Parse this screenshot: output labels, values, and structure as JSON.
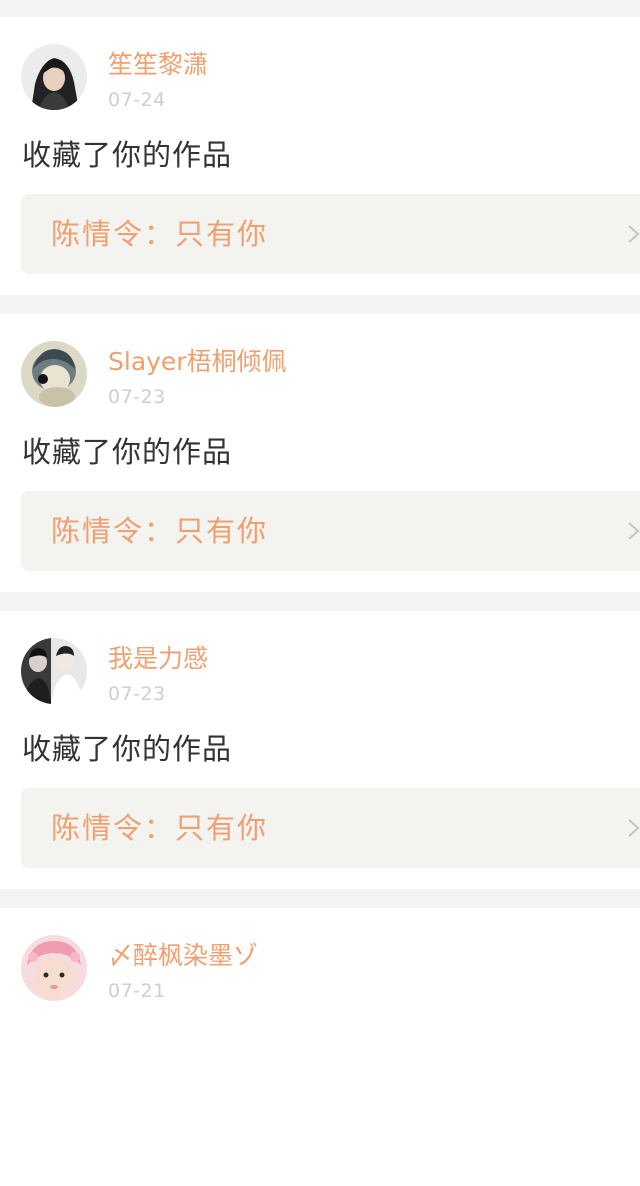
{
  "feed": {
    "items": [
      {
        "username": "笙笙黎潇",
        "date": "07-24",
        "action": "收藏了你的作品",
        "work_title": "陈情令：只有你",
        "avatar_icon": "user-avatar-photo"
      },
      {
        "username": "Slayer梧桐倾佩",
        "date": "07-23",
        "action": "收藏了你的作品",
        "work_title": "陈情令：只有你",
        "avatar_icon": "user-avatar-photo"
      },
      {
        "username": "我是力感",
        "date": "07-23",
        "action": "收藏了你的作品",
        "work_title": "陈情令：只有你",
        "avatar_icon": "user-avatar-photo"
      },
      {
        "username": "〆醉枫染墨ゾ",
        "date": "07-21",
        "avatar_icon": "user-avatar-photo"
      }
    ]
  },
  "colors": {
    "accent": "#f0a070",
    "date_gray": "#cfcfcf",
    "text": "#333333",
    "card_bg": "#ffffff",
    "page_bg": "#f4f4f4",
    "link_bg": "#f3f3ef"
  }
}
